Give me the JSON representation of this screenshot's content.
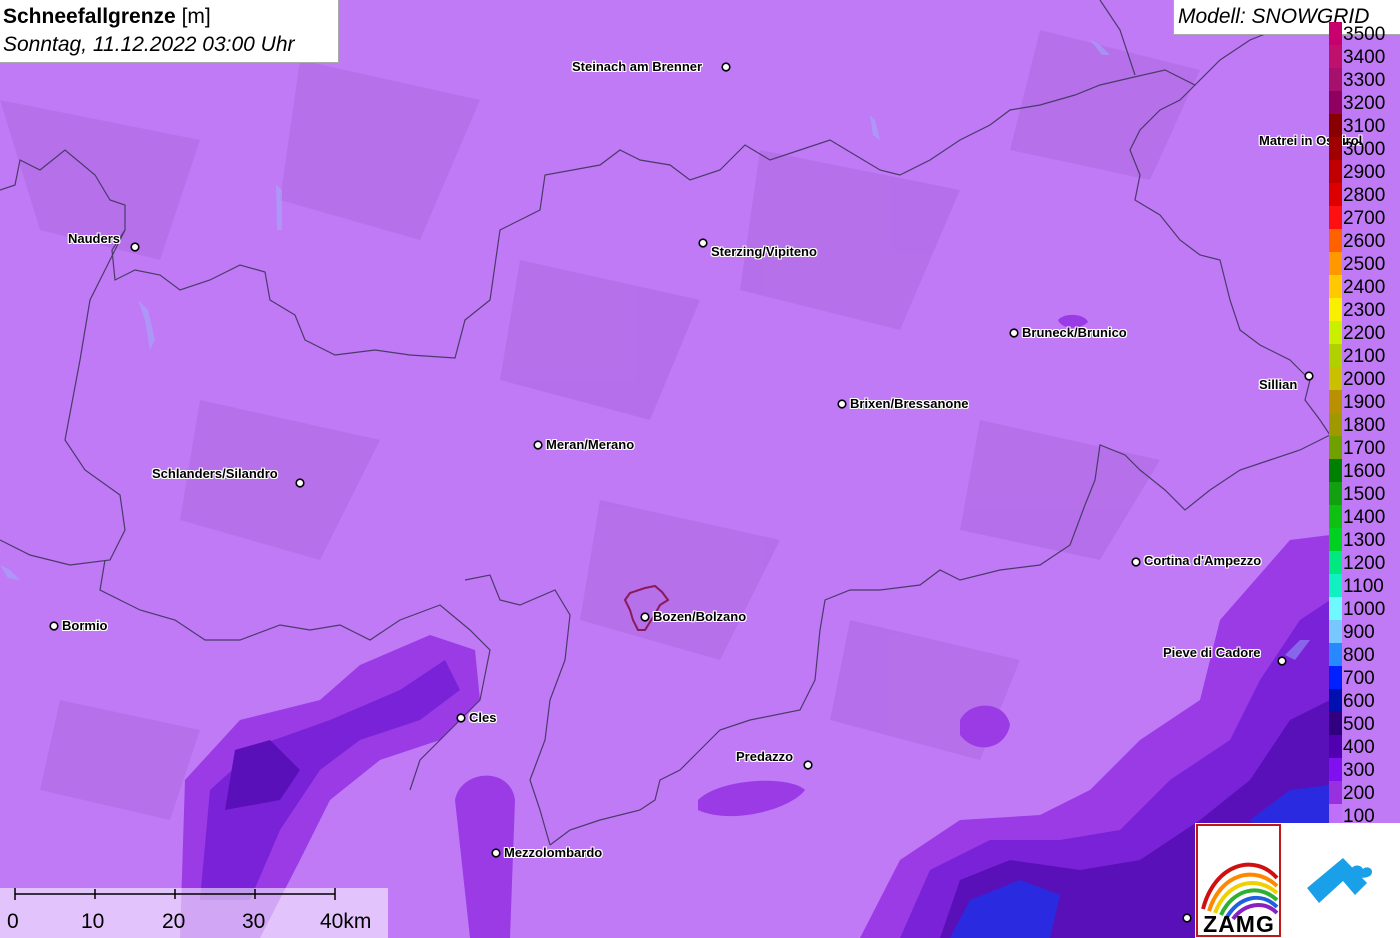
{
  "header": {
    "title_bold": "Schneefallgrenze",
    "title_unit": "[m]",
    "datetime": "Sonntag, 11.12.2022 03:00 Uhr",
    "model": "Modell: SNOWGRID"
  },
  "legend": {
    "items": [
      {
        "label": "3500",
        "color": "#c8006e"
      },
      {
        "label": "3400",
        "color": "#c0106e"
      },
      {
        "label": "3300",
        "color": "#a8106e"
      },
      {
        "label": "3200",
        "color": "#900060"
      },
      {
        "label": "3100",
        "color": "#880000"
      },
      {
        "label": "3000",
        "color": "#a00000"
      },
      {
        "label": "2900",
        "color": "#c00000"
      },
      {
        "label": "2800",
        "color": "#dc0000"
      },
      {
        "label": "2700",
        "color": "#ff1010"
      },
      {
        "label": "2600",
        "color": "#ff6000"
      },
      {
        "label": "2500",
        "color": "#ff9800"
      },
      {
        "label": "2400",
        "color": "#ffc800"
      },
      {
        "label": "2300",
        "color": "#f8f000"
      },
      {
        "label": "2200",
        "color": "#c8f000"
      },
      {
        "label": "2100",
        "color": "#b0d000"
      },
      {
        "label": "2000",
        "color": "#c8c000"
      },
      {
        "label": "1900",
        "color": "#b89000"
      },
      {
        "label": "1800",
        "color": "#a09800"
      },
      {
        "label": "1700",
        "color": "#70a000"
      },
      {
        "label": "1600",
        "color": "#008000"
      },
      {
        "label": "1500",
        "color": "#10a010"
      },
      {
        "label": "1400",
        "color": "#10c010"
      },
      {
        "label": "1300",
        "color": "#00d020"
      },
      {
        "label": "1200",
        "color": "#00e880"
      },
      {
        "label": "1100",
        "color": "#10f0c0"
      },
      {
        "label": "1000",
        "color": "#70f8ff"
      },
      {
        "label": "900",
        "color": "#78c8ff"
      },
      {
        "label": "800",
        "color": "#2888ff"
      },
      {
        "label": "700",
        "color": "#0020ff"
      },
      {
        "label": "600",
        "color": "#0010b0"
      },
      {
        "label": "500",
        "color": "#300080"
      },
      {
        "label": "400",
        "color": "#5000b0"
      },
      {
        "label": "300",
        "color": "#8010f0"
      },
      {
        "label": "200",
        "color": "#9830e0"
      },
      {
        "label": "100",
        "color": "#c070f8"
      }
    ]
  },
  "cities": [
    {
      "name": "Steinach am Brenner"
    },
    {
      "name": "Nauders"
    },
    {
      "name": "Sterzing/Vipiteno"
    },
    {
      "name": "Matrei in Osttirol"
    },
    {
      "name": "Bruneck/Brunico"
    },
    {
      "name": "Sillian"
    },
    {
      "name": "Brixen/Bressanone"
    },
    {
      "name": "Meran/Merano"
    },
    {
      "name": "Schlanders/Silandro"
    },
    {
      "name": "Cortina d'Ampezzo"
    },
    {
      "name": "Bormio"
    },
    {
      "name": "Bozen/Bolzano"
    },
    {
      "name": "Pieve di Cadore"
    },
    {
      "name": "Cles"
    },
    {
      "name": "Predazzo"
    },
    {
      "name": "Mezzolombardo"
    }
  ],
  "scale_bar": {
    "labels": [
      "0",
      "10",
      "20",
      "30",
      "40km"
    ]
  },
  "logos": {
    "zamg": "ZAMG"
  },
  "colors": {
    "base_snowline": "#c07af5",
    "low_snowline": "#9a3be6",
    "lower_snowline": "#7a22d8",
    "lowest_snowline": "#5a10b8",
    "deep_blue": "#2a2ae0",
    "border": "#4a3a6a"
  }
}
